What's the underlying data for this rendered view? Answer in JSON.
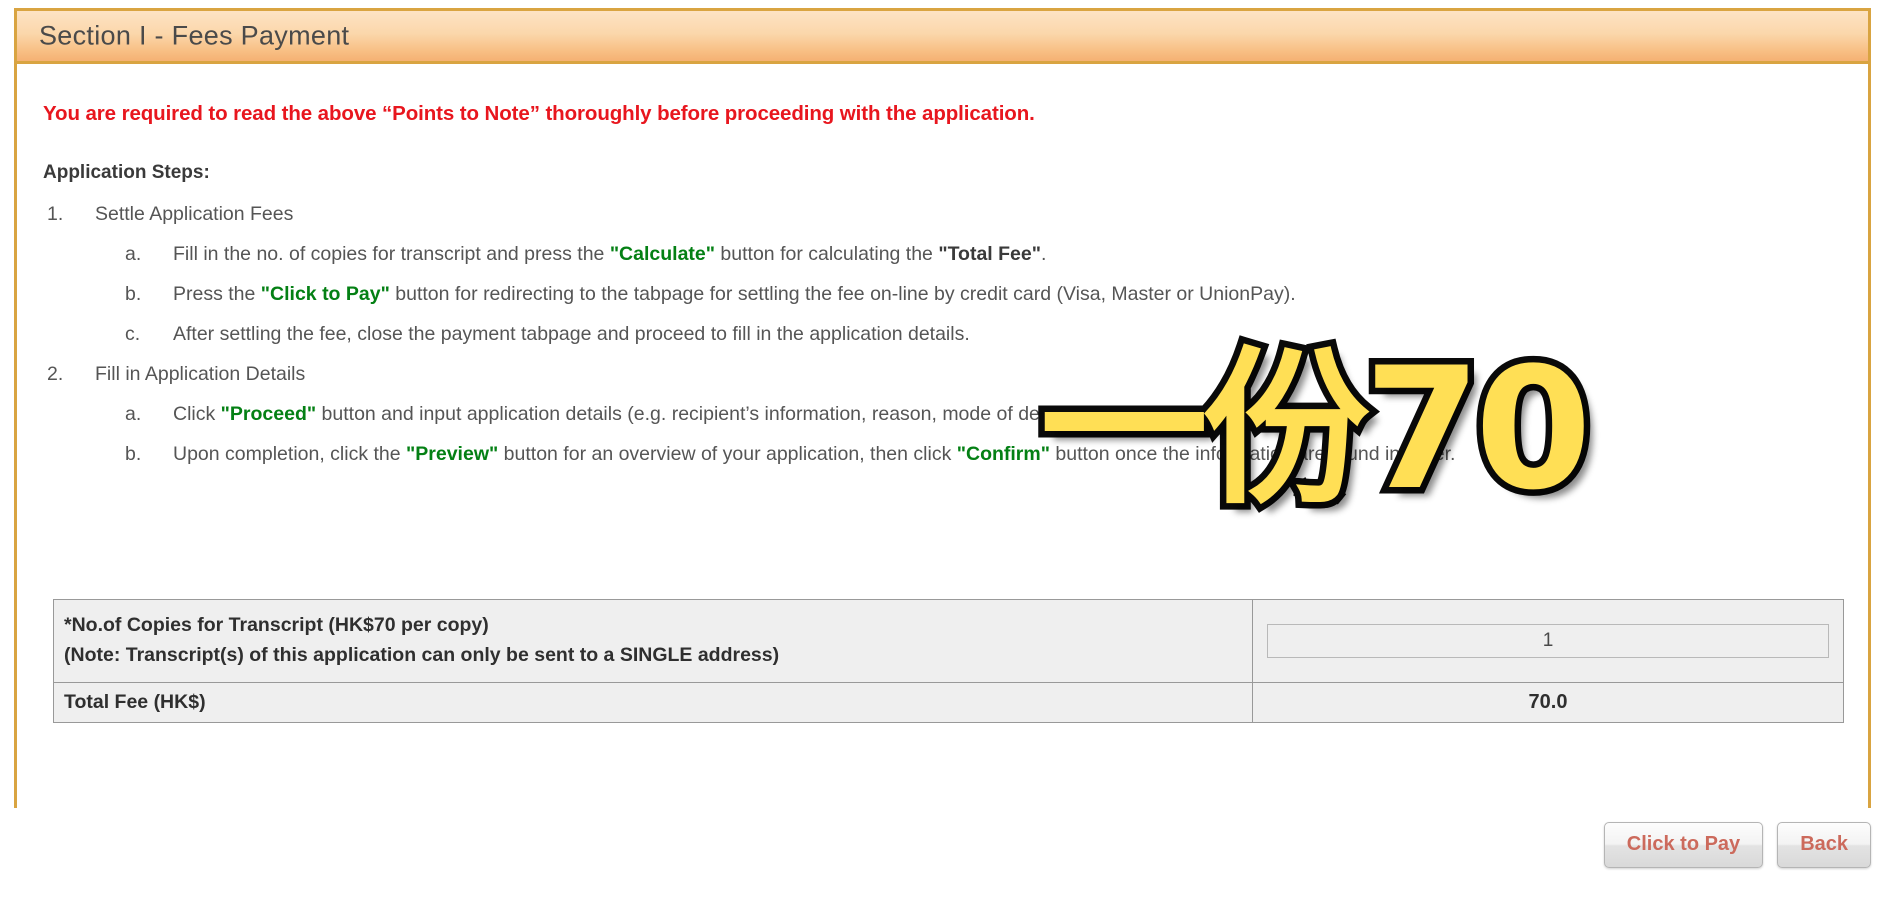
{
  "panel": {
    "title": "Section I - Fees Payment",
    "border_color": "#d9a441",
    "header_gradient_from": "#fde3c4",
    "header_gradient_to": "#f5b173"
  },
  "warning": {
    "text": "You are required to read the above “Points to Note” thoroughly before proceeding with the application.",
    "color": "#e8161e"
  },
  "steps": {
    "heading": "Application Steps:",
    "items": [
      {
        "marker": "1.",
        "level": 1,
        "parts": [
          {
            "t": "Settle Application Fees",
            "s": "plain"
          }
        ]
      },
      {
        "marker": "a.",
        "level": 2,
        "parts": [
          {
            "t": "Fill in the no. of copies for transcript and press the ",
            "s": "plain"
          },
          {
            "t": "\"Calculate\"",
            "s": "green"
          },
          {
            "t": " button for calculating the ",
            "s": "plain"
          },
          {
            "t": "\"Total Fee\"",
            "s": "dark"
          },
          {
            "t": ".",
            "s": "plain"
          }
        ]
      },
      {
        "marker": "b.",
        "level": 2,
        "parts": [
          {
            "t": "Press the ",
            "s": "plain"
          },
          {
            "t": "\"Click to Pay\"",
            "s": "green"
          },
          {
            "t": " button for redirecting to the tabpage for settling the fee on-line by credit card (Visa, Master or UnionPay).",
            "s": "plain"
          }
        ]
      },
      {
        "marker": "c.",
        "level": 2,
        "parts": [
          {
            "t": "After settling the fee, close the payment tabpage and proceed to fill in the application details.",
            "s": "plain"
          }
        ]
      },
      {
        "marker": "2.",
        "level": 1,
        "parts": [
          {
            "t": "Fill in Application Details",
            "s": "plain"
          }
        ]
      },
      {
        "marker": "a.",
        "level": 2,
        "parts": [
          {
            "t": "Click ",
            "s": "plain"
          },
          {
            "t": "\"Proceed\"",
            "s": "green"
          },
          {
            "t": " button and input application details (e.g. recipient’s information, reason, mode of delivery for transcript, etc.).",
            "s": "plain"
          }
        ]
      },
      {
        "marker": "b.",
        "level": 2,
        "parts": [
          {
            "t": "Upon completion, click the ",
            "s": "plain"
          },
          {
            "t": "\"Preview\"",
            "s": "green"
          },
          {
            "t": " button for an overview of your application, then click ",
            "s": "plain"
          },
          {
            "t": "\"Confirm\"",
            "s": "green"
          },
          {
            "t": " button once the information are found in order.",
            "s": "plain"
          }
        ]
      }
    ]
  },
  "fee_table": {
    "rows": [
      {
        "label_line1": "*No.of Copies for Transcript (HK$70 per copy)",
        "label_line2": "(Note: Transcript(s) of this application can only be sent to a SINGLE address)",
        "value": "1",
        "type": "input"
      },
      {
        "label_line1": "Total Fee (HK$)",
        "label_line2": "",
        "value": "70.0",
        "type": "text"
      }
    ]
  },
  "buttons": {
    "pay_label": "Click to Pay",
    "back_label": "Back",
    "text_color": "#cc6a5c"
  },
  "annotation": {
    "text": "一份70",
    "fill_color": "#ffdf55",
    "stroke_color": "#0a0a0a"
  }
}
